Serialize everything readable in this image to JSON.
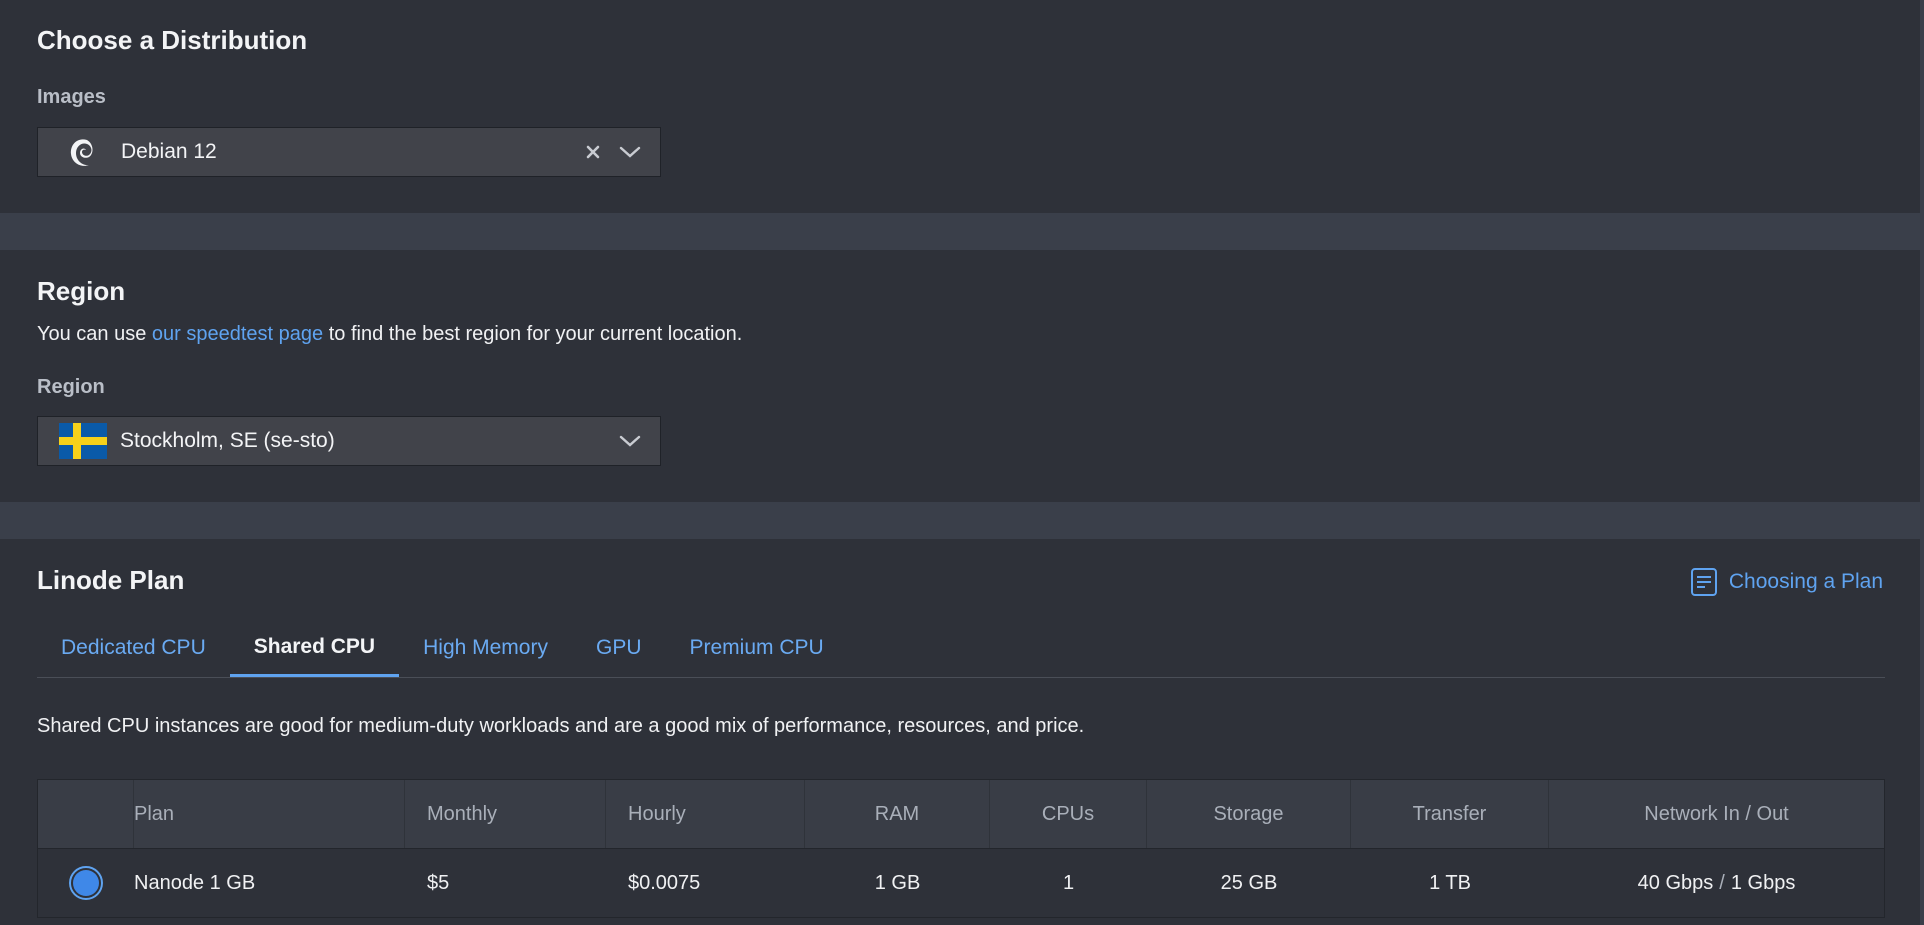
{
  "distribution": {
    "title": "Choose a Distribution",
    "images_label": "Images",
    "selected_image": "Debian 12",
    "image_icon": "debian-swirl-icon"
  },
  "region": {
    "title": "Region",
    "helper_prefix": "You can use ",
    "helper_link": "our speedtest page",
    "helper_suffix": " to find the best region for your current location.",
    "field_label": "Region",
    "selected_region": "Stockholm, SE (se-sto)",
    "flag_icon": "sweden-flag-icon",
    "flag_colors": {
      "blue": "#0a5aa8",
      "yellow": "#f6d11a"
    }
  },
  "plan": {
    "title": "Linode Plan",
    "help_link": "Choosing a Plan",
    "tabs": [
      {
        "label": "Dedicated CPU",
        "active": false
      },
      {
        "label": "Shared CPU",
        "active": true
      },
      {
        "label": "High Memory",
        "active": false
      },
      {
        "label": "GPU",
        "active": false
      },
      {
        "label": "Premium CPU",
        "active": false
      }
    ],
    "description": "Shared CPU instances are good for medium-duty workloads and are a good mix of performance, resources, and price.",
    "columns": [
      "Plan",
      "Monthly",
      "Hourly",
      "RAM",
      "CPUs",
      "Storage",
      "Transfer",
      "Network In / Out"
    ],
    "rows": [
      {
        "selected": true,
        "plan": "Nanode 1 GB",
        "monthly": "$5",
        "hourly": "$0.0075",
        "ram": "1 GB",
        "cpus": "1",
        "storage": "25 GB",
        "transfer": "1 TB",
        "network_in": "40 Gbps",
        "network_sep": "/",
        "network_out": "1 Gbps"
      }
    ]
  },
  "colors": {
    "background": "#3a3f4a",
    "panel": "#2e3139",
    "accent": "#5fa3f0",
    "radio_fill": "#3f88e8"
  }
}
